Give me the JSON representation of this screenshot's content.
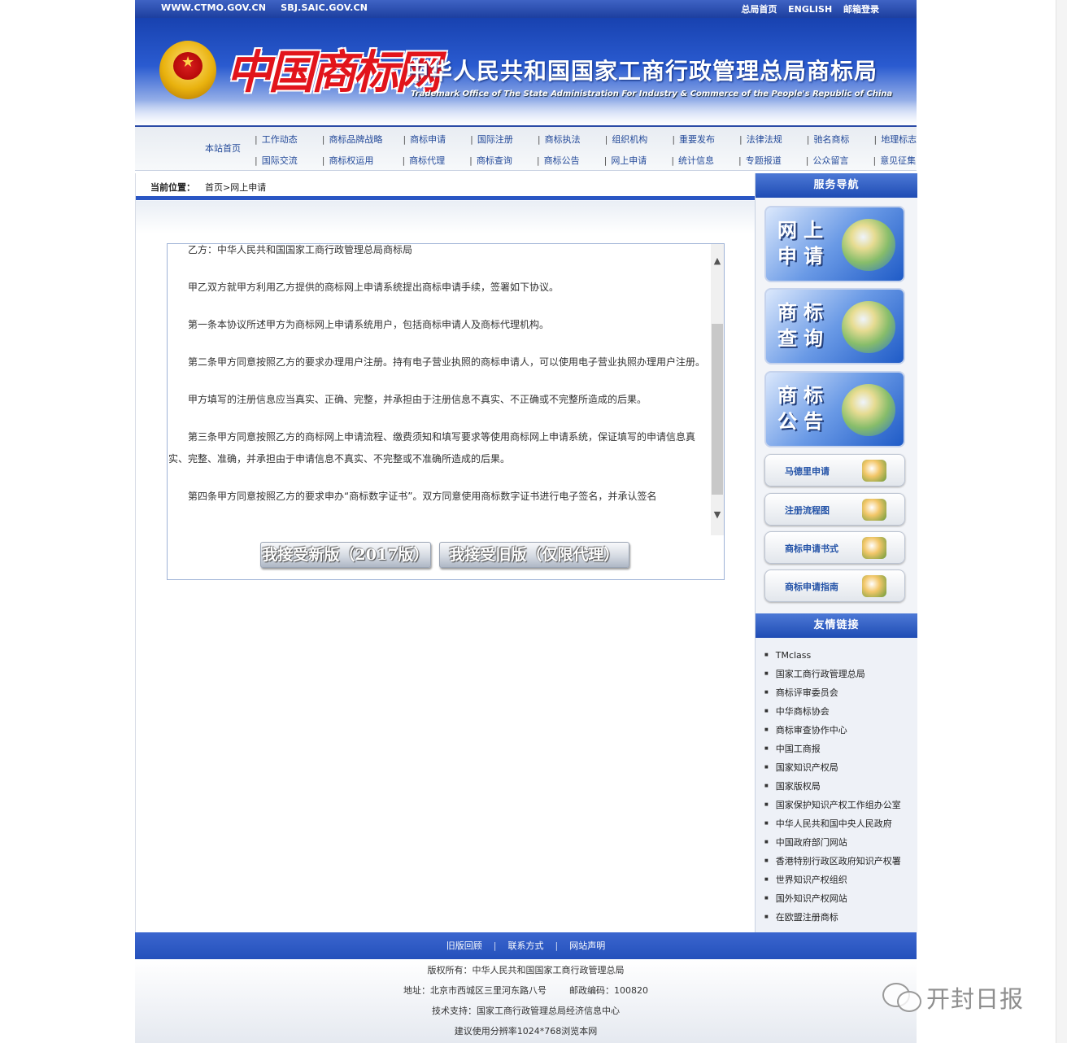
{
  "topbar": {
    "left_links": [
      "WWW.CTMO.GOV.CN",
      "SBJ.SAIC.GOV.CN"
    ],
    "right_links": [
      "总局首页",
      "ENGLISH",
      "邮箱登录"
    ]
  },
  "banner": {
    "logo_text": "中国商标网",
    "title_cn": "中华人民共和国国家工商行政管理总局商标局",
    "title_en": "Trademark Office of The State Administration For Industry & Commerce of the People's Republic of China"
  },
  "nav": {
    "home": "本站首页",
    "row1": [
      "工作动态",
      "商标品牌战略",
      "商标申请",
      "国际注册",
      "商标执法",
      "组织机构",
      "重要发布",
      "法律法规",
      "驰名商标",
      "地理标志"
    ],
    "row2": [
      "国际交流",
      "商标权运用",
      "商标代理",
      "商标查询",
      "商标公告",
      "网上申请",
      "统计信息",
      "专题报道",
      "公众留言",
      "意见征集"
    ]
  },
  "breadcrumb": {
    "label": "当前位置：",
    "path": "首页>网上申请"
  },
  "agreement": {
    "paragraphs": [
      "乙方：中华人民共和国国家工商行政管理总局商标局",
      "甲乙双方就甲方利用乙方提供的商标网上申请系统提出商标申请手续，签署如下协议。",
      "第一条本协议所述甲方为商标网上申请系统用户，包括商标申请人及商标代理机构。",
      "第二条甲方同意按照乙方的要求办理用户注册。持有电子营业执照的商标申请人，可以使用电子营业执照办理用户注册。",
      "甲方填写的注册信息应当真实、正确、完整，并承担由于注册信息不真实、不正确或不完整所造成的后果。",
      "第三条甲方同意按照乙方的商标网上申请流程、缴费须知和填写要求等使用商标网上申请系统，保证填写的申请信息真实、完整、准确，并承担由于申请信息不真实、不完整或不准确所造成的后果。",
      "第四条甲方同意按照乙方的要求申办“商标数字证书”。双方同意使用商标数字证书进行电子签名，并承认签名"
    ],
    "accept_new": "我接受新版（2017版）",
    "accept_old": "我接受旧版（仅限代理）"
  },
  "sidebar": {
    "service_title": "服务导航",
    "big_services": [
      "网上申请",
      "商标查询",
      "商标公告"
    ],
    "small_services": [
      "马德里申请",
      "注册流程图",
      "商标申请书式",
      "商标申请指南"
    ],
    "links_title": "友情链接",
    "links": [
      "TMclass",
      "国家工商行政管理总局",
      "商标评审委员会",
      "中华商标协会",
      "商标审查协作中心",
      "中国工商报",
      "国家知识产权局",
      "国家版权局",
      "国家保护知识产权工作组办公室",
      "中华人民共和国中央人民政府",
      "中国政府部门网站",
      "香港特别行政区政府知识产权署",
      "世界知识产权组织",
      "国外知识产权网站",
      "在欧盟注册商标"
    ]
  },
  "footer": {
    "links": [
      "旧版回顾",
      "联系方式",
      "网站声明"
    ],
    "copyright": "版权所有：中华人民共和国国家工商行政管理总局",
    "address": "地址：北京市西城区三里河东路八号",
    "postcode": "邮政编码：100820",
    "support": "技术支持：国家工商行政管理总局经济信息中心",
    "resolution": "建议使用分辨率1024*768浏览本网"
  },
  "watermark": {
    "text": "开封日报"
  }
}
